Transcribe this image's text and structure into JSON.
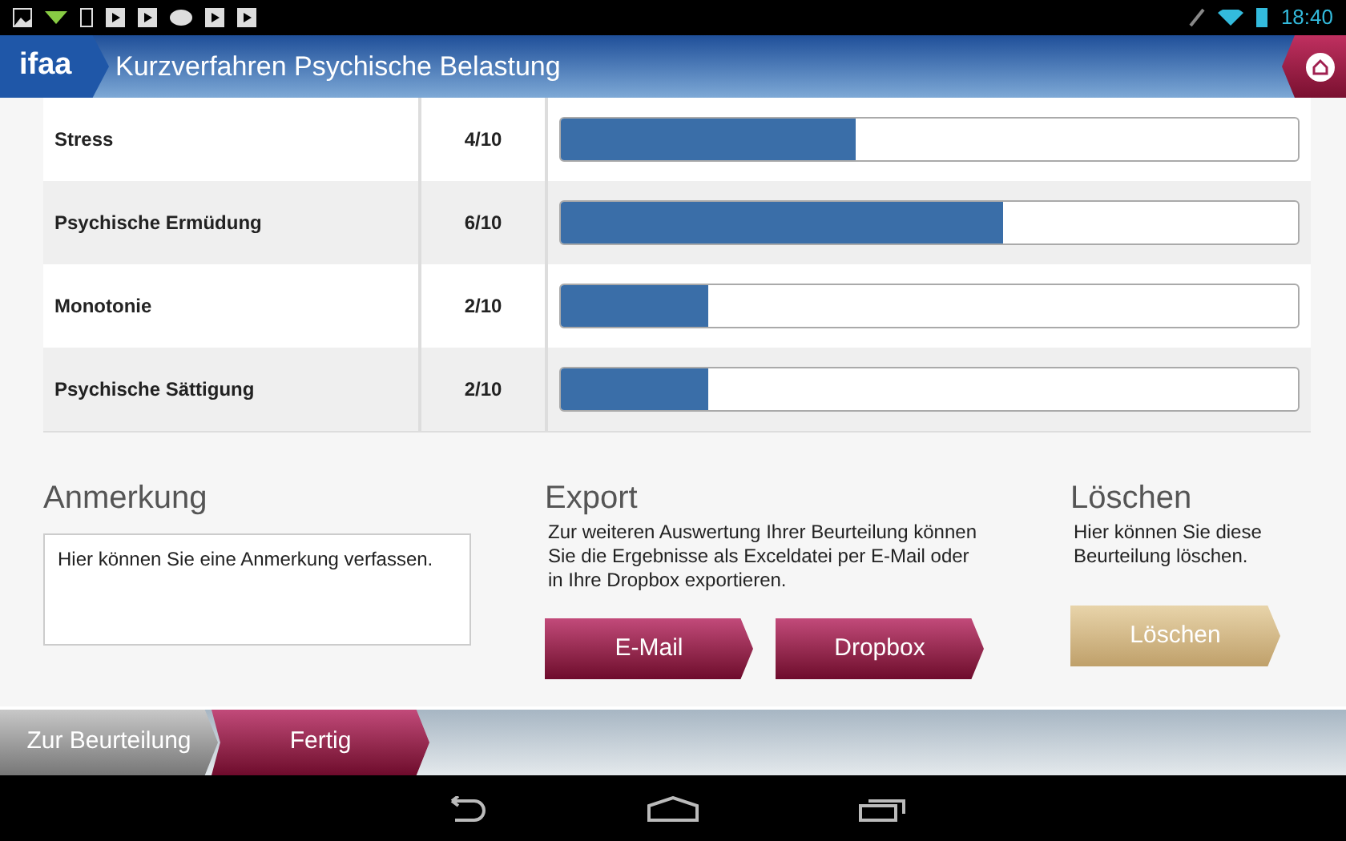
{
  "status_bar": {
    "time": "18:40"
  },
  "header": {
    "logo": "ifaa",
    "title": "Kurzverfahren Psychische Belastung"
  },
  "results": [
    {
      "name": "Stress",
      "score": "4/10",
      "level": 0.4
    },
    {
      "name": "Psychische Ermüdung",
      "score": "6/10",
      "level": 0.6
    },
    {
      "name": "Monotonie",
      "score": "2/10",
      "level": 0.2
    },
    {
      "name": "Psychische Sättigung",
      "score": "2/10",
      "level": 0.2
    }
  ],
  "note": {
    "heading": "Anmerkung",
    "placeholder": "Hier können Sie eine Anmerkung verfassen."
  },
  "export": {
    "heading": "Export",
    "text": "Zur weiteren Auswertung Ihrer Beurteilung können Sie die Ergebnisse als Exceldatei per E-Mail oder in Ihre Dropbox exportieren.",
    "buttons": [
      "E-Mail",
      "Dropbox"
    ]
  },
  "delete": {
    "heading": "Löschen",
    "text": "Hier können Sie diese Beurteilung löschen.",
    "button": "Löschen"
  },
  "bottom_tabs": [
    {
      "label": "Zur Beurteilung",
      "selected": false
    },
    {
      "label": "Fertig",
      "selected": true
    }
  ]
}
